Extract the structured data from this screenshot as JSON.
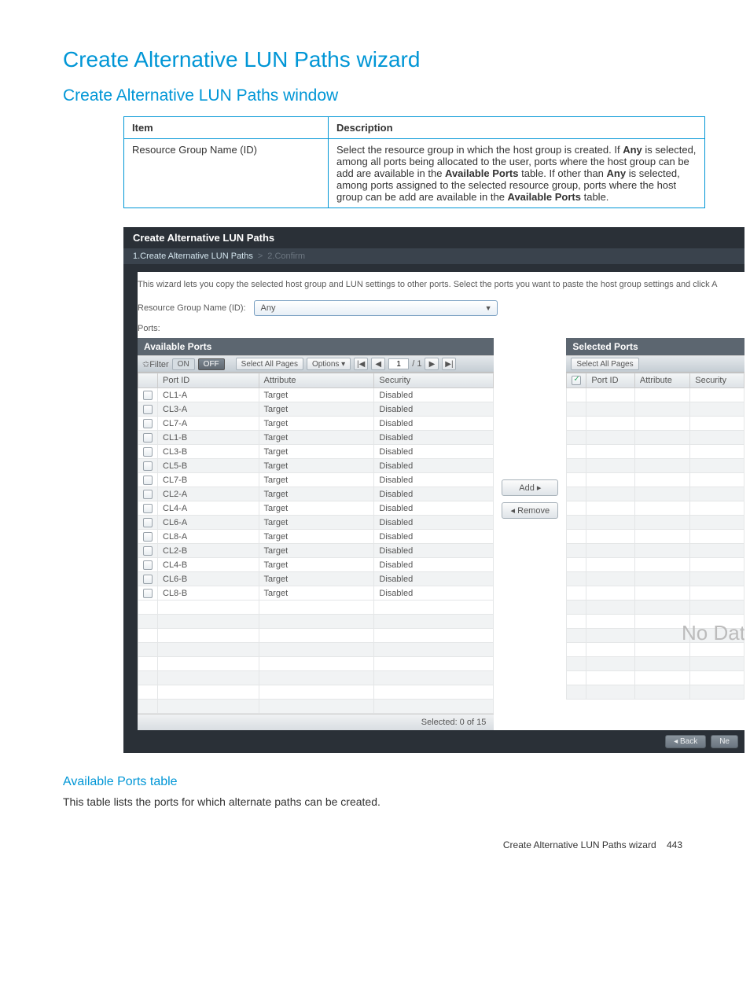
{
  "headings": {
    "h1": "Create Alternative LUN Paths wizard",
    "h2": "Create Alternative LUN Paths window",
    "h3": "Available Ports table",
    "body_text": "This table lists the ports for which alternate paths can be created."
  },
  "desc_table": {
    "headers": [
      "Item",
      "Description"
    ],
    "item": "Resource Group Name (ID)",
    "description": "Select the resource group in which the host group is created. If Any is selected, among all ports being allocated to the user, ports where the host group can be add are available in the Available Ports table. If other than Any is selected, among ports assigned to the selected resource group, ports where the host group can be add are available in the Available Ports table."
  },
  "wizard": {
    "title": "Create Alternative LUN Paths",
    "step1": "1.Create Alternative LUN Paths",
    "step_sep": ">",
    "step2": "2.Confirm",
    "intro": "This wizard lets you copy the selected host group and LUN settings to other ports. Select the ports you want to paste the host group settings and click A",
    "field_label": "Resource Group Name (ID):",
    "field_value": "Any",
    "ports_label": "Ports:",
    "available": {
      "header": "Available Ports",
      "filter_label": "✩Filter",
      "on": "ON",
      "off": "OFF",
      "select_all": "Select All Pages",
      "options": "Options ▾",
      "first_icon": "|◀",
      "prev_icon": "◀",
      "page_value": "1",
      "page_sep": "/ 1",
      "next_icon": "▶",
      "last_icon": "▶|",
      "cols": [
        "Port ID",
        "Attribute",
        "Security"
      ],
      "rows": [
        {
          "port": "CL1-A",
          "attr": "Target",
          "sec": "Disabled",
          "alt": false
        },
        {
          "port": "CL3-A",
          "attr": "Target",
          "sec": "Disabled",
          "alt": true
        },
        {
          "port": "CL7-A",
          "attr": "Target",
          "sec": "Disabled",
          "alt": false
        },
        {
          "port": "CL1-B",
          "attr": "Target",
          "sec": "Disabled",
          "alt": true
        },
        {
          "port": "CL3-B",
          "attr": "Target",
          "sec": "Disabled",
          "alt": false
        },
        {
          "port": "CL5-B",
          "attr": "Target",
          "sec": "Disabled",
          "alt": true
        },
        {
          "port": "CL7-B",
          "attr": "Target",
          "sec": "Disabled",
          "alt": false
        },
        {
          "port": "CL2-A",
          "attr": "Target",
          "sec": "Disabled",
          "alt": true
        },
        {
          "port": "CL4-A",
          "attr": "Target",
          "sec": "Disabled",
          "alt": false
        },
        {
          "port": "CL6-A",
          "attr": "Target",
          "sec": "Disabled",
          "alt": true
        },
        {
          "port": "CL8-A",
          "attr": "Target",
          "sec": "Disabled",
          "alt": false
        },
        {
          "port": "CL2-B",
          "attr": "Target",
          "sec": "Disabled",
          "alt": true
        },
        {
          "port": "CL4-B",
          "attr": "Target",
          "sec": "Disabled",
          "alt": false
        },
        {
          "port": "CL6-B",
          "attr": "Target",
          "sec": "Disabled",
          "alt": true
        },
        {
          "port": "CL8-B",
          "attr": "Target",
          "sec": "Disabled",
          "alt": false
        }
      ],
      "empty_rows": 8,
      "footer": "Selected:  0   of  15"
    },
    "buttons": {
      "add": "Add ▸",
      "remove": "◂ Remove"
    },
    "selected": {
      "header": "Selected Ports",
      "select_all": "Select All Pages",
      "cols": [
        "Port ID",
        "Attribute",
        "Security"
      ],
      "nodata": "No Dat",
      "empty_rows": 22
    },
    "nav": {
      "back": "◂ Back",
      "next": "Ne"
    }
  },
  "footer": {
    "title": "Create Alternative LUN Paths wizard",
    "page": "443"
  }
}
